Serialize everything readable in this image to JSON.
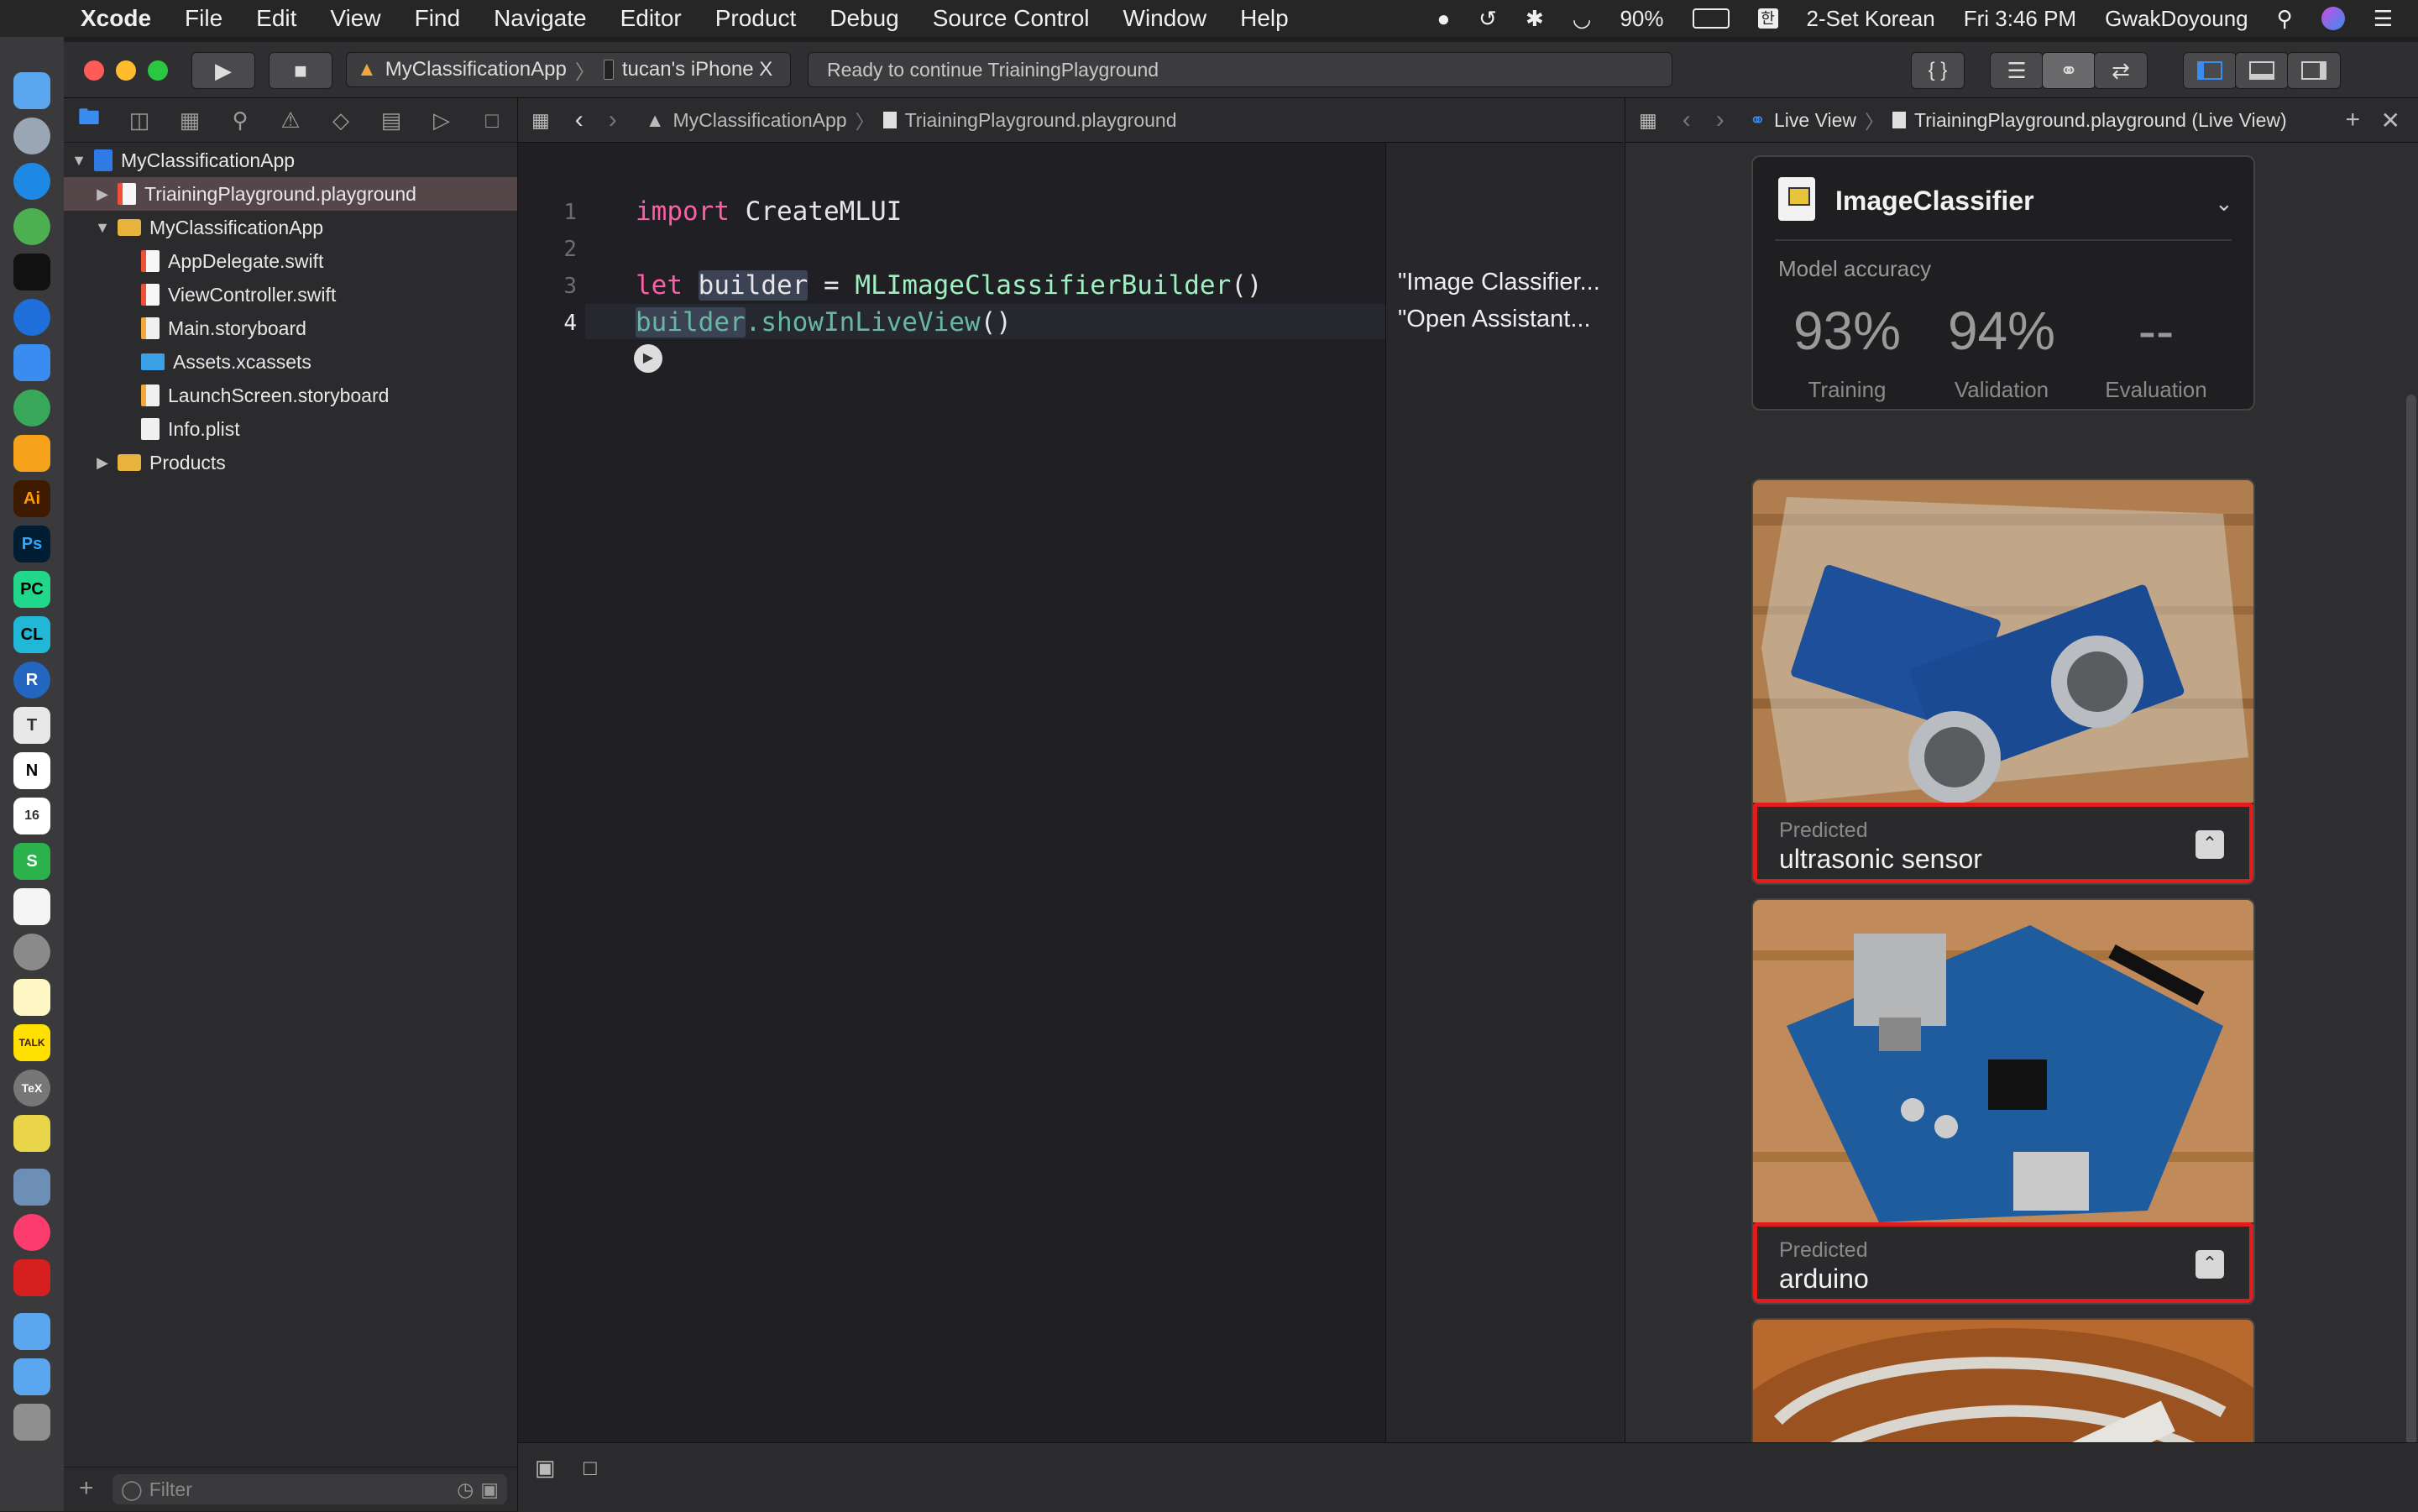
{
  "menubar": {
    "apple": "",
    "app": "Xcode",
    "menus": [
      "File",
      "Edit",
      "View",
      "Find",
      "Navigate",
      "Editor",
      "Product",
      "Debug",
      "Source Control",
      "Window",
      "Help"
    ],
    "battery": "90%",
    "input_source": "2-Set Korean",
    "clock": "Fri 3:46 PM",
    "user": "GwakDoyoung"
  },
  "toolbar": {
    "scheme": "MyClassificationApp",
    "device": "tucan's iPhone X",
    "status": "Ready to continue TriainingPlayground",
    "braces": "{ }"
  },
  "navigator": {
    "items": [
      {
        "label": "MyClassificationApp",
        "icon": "project-icon"
      },
      {
        "label": "TriainingPlayground.playground",
        "icon": "playground-icon"
      },
      {
        "label": "MyClassificationApp",
        "icon": "folder-icon"
      },
      {
        "label": "AppDelegate.swift",
        "icon": "swift-file-icon"
      },
      {
        "label": "ViewController.swift",
        "icon": "swift-file-icon"
      },
      {
        "label": "Main.storyboard",
        "icon": "storyboard-icon"
      },
      {
        "label": "Assets.xcassets",
        "icon": "assets-icon"
      },
      {
        "label": "LaunchScreen.storyboard",
        "icon": "storyboard-icon"
      },
      {
        "label": "Info.plist",
        "icon": "plist-icon"
      },
      {
        "label": "Products",
        "icon": "folder-icon"
      }
    ],
    "filter_placeholder": "Filter"
  },
  "editor": {
    "breadcrumb": [
      "MyClassificationApp",
      "TriainingPlayground.playground"
    ],
    "line_numbers": [
      "1",
      "2",
      "3",
      "4"
    ],
    "code": {
      "l1_kw": "import",
      "l1_rest": " CreateMLUI",
      "l3_kw": "let",
      "l3_var": "builder",
      "l3_eq": " = ",
      "l3_type": "MLImageClassifierBuilder",
      "l3_paren": "()",
      "l4_var": "builder",
      "l4_method": ".showInLiveView",
      "l4_paren": "()"
    },
    "results": [
      "\"Image Classifier...",
      "\"Open Assistant..."
    ]
  },
  "liveview": {
    "breadcrumb": [
      "Live View",
      "TriainingPlayground.playground (Live View)"
    ],
    "title": "ImageClassifier",
    "model_accuracy_label": "Model accuracy",
    "accuracy": [
      {
        "value": "93%",
        "label": "Training"
      },
      {
        "value": "94%",
        "label": "Validation"
      },
      {
        "value": "--",
        "label": "Evaluation"
      }
    ],
    "predictions": [
      {
        "label": "Predicted",
        "value": "ultrasonic sensor"
      },
      {
        "label": "Predicted",
        "value": "arduino"
      }
    ]
  },
  "colors": {
    "accent": "#3b8cf0",
    "highlight_red": "#e21b1b",
    "keyword": "#fc5fa3",
    "type": "#9ef0c0"
  }
}
